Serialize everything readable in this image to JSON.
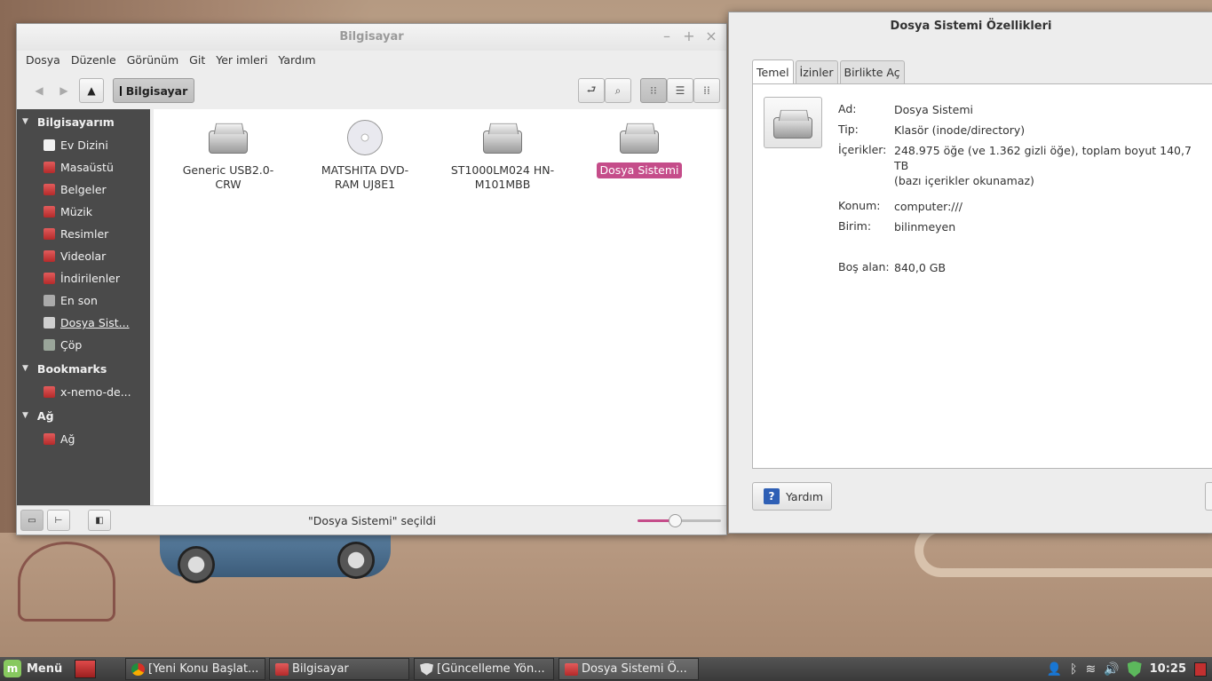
{
  "nemo": {
    "title": "Bilgisayar",
    "menu": [
      "Dosya",
      "Düzenle",
      "Görünüm",
      "Git",
      "Yer imleri",
      "Yardım"
    ],
    "breadcrumb": "Bilgisayar",
    "sidebar": {
      "sections": [
        {
          "header": "Bilgisayarım",
          "items": [
            {
              "label": "Ev Dizini",
              "icon": "home-icon"
            },
            {
              "label": "Masaüstü",
              "icon": "desktop-folder-icon"
            },
            {
              "label": "Belgeler",
              "icon": "documents-folder-icon"
            },
            {
              "label": "Müzik",
              "icon": "music-folder-icon"
            },
            {
              "label": "Resimler",
              "icon": "pictures-folder-icon"
            },
            {
              "label": "Videolar",
              "icon": "videos-folder-icon"
            },
            {
              "label": "İndirilenler",
              "icon": "downloads-folder-icon"
            },
            {
              "label": "En son",
              "icon": "recent-icon"
            },
            {
              "label": "Dosya Sist...",
              "icon": "drive-icon"
            },
            {
              "label": "Çöp",
              "icon": "trash-icon"
            }
          ]
        },
        {
          "header": "Bookmarks",
          "items": [
            {
              "label": "x-nemo-de...",
              "icon": "bookmark-folder-icon"
            }
          ]
        },
        {
          "header": "Ağ",
          "items": [
            {
              "label": "Ağ",
              "icon": "network-icon"
            }
          ]
        }
      ]
    },
    "files": [
      {
        "name": "Generic USB2.0-CRW",
        "icon": "usb-drive-icon",
        "selected": false
      },
      {
        "name": "MATSHITA DVD-RAM UJ8E1",
        "icon": "optical-disc-icon",
        "selected": false
      },
      {
        "name": "ST1000LM024 HN-M101MBB",
        "icon": "hard-drive-icon",
        "selected": false
      },
      {
        "name": "Dosya Sistemi",
        "icon": "hard-drive-icon",
        "selected": true
      }
    ],
    "status": "\"Dosya Sistemi\" seçildi",
    "zoom_level": 0.45
  },
  "properties": {
    "title": "Dosya Sistemi Özellikleri",
    "tabs": [
      "Temel",
      "İzinler",
      "Birlikte Aç"
    ],
    "active_tab": "Temel",
    "fields": {
      "name_key": "Ad:",
      "name_value": "Dosya Sistemi",
      "type_key": "Tip:",
      "type_value": "Klasör (inode/directory)",
      "contents_key": "İçerikler:",
      "contents_value": "248.975 öğe (ve 1.362 gizli öğe), toplam boyut 140,7 TB",
      "contents_note": "(bazı içerikler okunamaz)",
      "location_key": "Konum:",
      "location_value": "computer:///",
      "volume_key": "Birim:",
      "volume_value": "bilinmeyen",
      "free_key": "Boş alan:",
      "free_value": "840,0 GB"
    },
    "help_button": "Yardım"
  },
  "taskbar": {
    "menu_label": "Menü",
    "tasks": [
      {
        "label": "[Yeni Konu Başlat...",
        "icon": "chrome-icon"
      },
      {
        "label": "Bilgisayar",
        "icon": "folder-icon"
      },
      {
        "label": "[Güncelleme Yön...",
        "icon": "shield-icon"
      },
      {
        "label": "Dosya Sistemi Ö...",
        "icon": "folder-icon"
      }
    ],
    "clock": "10:25"
  },
  "colors": {
    "selection": "#c54d8a",
    "sidebar_bg": "#4a4a4a",
    "mint_green": "#87c95f"
  }
}
